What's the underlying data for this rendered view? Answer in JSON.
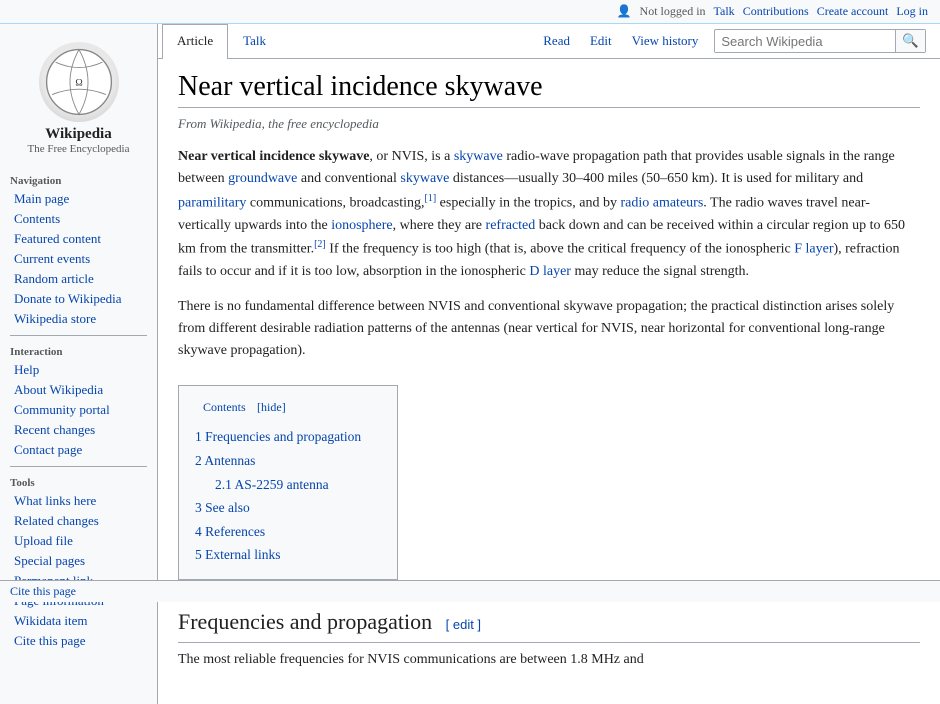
{
  "topbar": {
    "not_logged_in": "Not logged in",
    "talk": "Talk",
    "contributions": "Contributions",
    "create_account": "Create account",
    "log_in": "Log in",
    "user_icon": "👤"
  },
  "logo": {
    "title": "Wikipedia",
    "subtitle": "The Free Encyclopedia"
  },
  "sidebar": {
    "navigation_heading": "Navigation",
    "items_navigation": [
      {
        "label": "Main page",
        "id": "main-page"
      },
      {
        "label": "Contents",
        "id": "contents"
      },
      {
        "label": "Featured content",
        "id": "featured-content"
      },
      {
        "label": "Current events",
        "id": "current-events"
      },
      {
        "label": "Random article",
        "id": "random-article"
      },
      {
        "label": "Donate to Wikipedia",
        "id": "donate"
      },
      {
        "label": "Wikipedia store",
        "id": "store"
      }
    ],
    "interaction_heading": "Interaction",
    "items_interaction": [
      {
        "label": "Help",
        "id": "help"
      },
      {
        "label": "About Wikipedia",
        "id": "about"
      },
      {
        "label": "Community portal",
        "id": "community"
      },
      {
        "label": "Recent changes",
        "id": "recent-changes"
      },
      {
        "label": "Contact page",
        "id": "contact"
      }
    ],
    "tools_heading": "Tools",
    "items_tools": [
      {
        "label": "What links here",
        "id": "what-links"
      },
      {
        "label": "Related changes",
        "id": "related-changes"
      },
      {
        "label": "Upload file",
        "id": "upload"
      },
      {
        "label": "Special pages",
        "id": "special"
      },
      {
        "label": "Permanent link",
        "id": "permanent"
      },
      {
        "label": "Page information",
        "id": "page-info"
      },
      {
        "label": "Wikidata item",
        "id": "wikidata"
      },
      {
        "label": "Cite this page",
        "id": "cite"
      }
    ]
  },
  "tabs": {
    "article": "Article",
    "talk": "Talk",
    "read": "Read",
    "edit": "Edit",
    "view_history": "View history"
  },
  "search": {
    "placeholder": "Search Wikipedia",
    "value": ""
  },
  "article": {
    "title": "Near vertical incidence skywave",
    "from_wikipedia": "From Wikipedia, the free encyclopedia",
    "body": {
      "para1_bold": "Near vertical incidence skywave",
      "para1_rest": ", or NVIS, is a ",
      "skywave1": "skywave",
      "para1_mid": " radio-wave propagation path that provides usable signals in the range between ",
      "groundwave": "groundwave",
      "para1_mid2": " and conventional ",
      "skywave2": "skywave",
      "para1_mid3": " distances—usually 30–400 miles (50–650 km). It is used for military and ",
      "paramilitary": "paramilitary",
      "para1_mid4": " communications, broadcasting,",
      "cite1": "[1]",
      "para1_mid5": " especially in the tropics, and by ",
      "radio_amateurs": "radio amateurs",
      "para1_mid6": ". The radio waves travel near-vertically upwards into the ",
      "ionosphere": "ionosphere",
      "para1_mid7": ", where they are ",
      "refracted": "refracted",
      "para1_mid8": " back down and can be received within a circular region up to 650 km from the transmitter.",
      "cite2": "[2]",
      "para1_end": " If the frequency is too high (that is, above the critical frequency of the ionospheric ",
      "flayer": "F layer",
      "para1_end2": "), refraction fails to occur and if it is too low, absorption in the ionospheric ",
      "dlayer": "D layer",
      "para1_end3": " may reduce the signal strength.",
      "para2": "There is no fundamental difference between NVIS and conventional skywave propagation; the practical distinction arises solely from different desirable radiation patterns of the antennas (near vertical for NVIS, near horizontal for conventional long-range skywave propagation)."
    },
    "toc": {
      "title": "Contents",
      "hide": "[hide]",
      "items": [
        {
          "num": "1",
          "label": "Frequencies and propagation"
        },
        {
          "num": "2",
          "label": "Antennas"
        },
        {
          "num": "2.1",
          "label": "AS-2259 antenna",
          "sub": true
        },
        {
          "num": "3",
          "label": "See also"
        },
        {
          "num": "4",
          "label": "References"
        },
        {
          "num": "5",
          "label": "External links"
        }
      ]
    },
    "section1": {
      "heading": "Frequencies and propagation",
      "edit_link": "[ edit ]",
      "body": "The most reliable frequencies for NVIS communications are between 1.8 MHz and"
    }
  },
  "bottombar": {
    "cite": "Cite this page"
  }
}
